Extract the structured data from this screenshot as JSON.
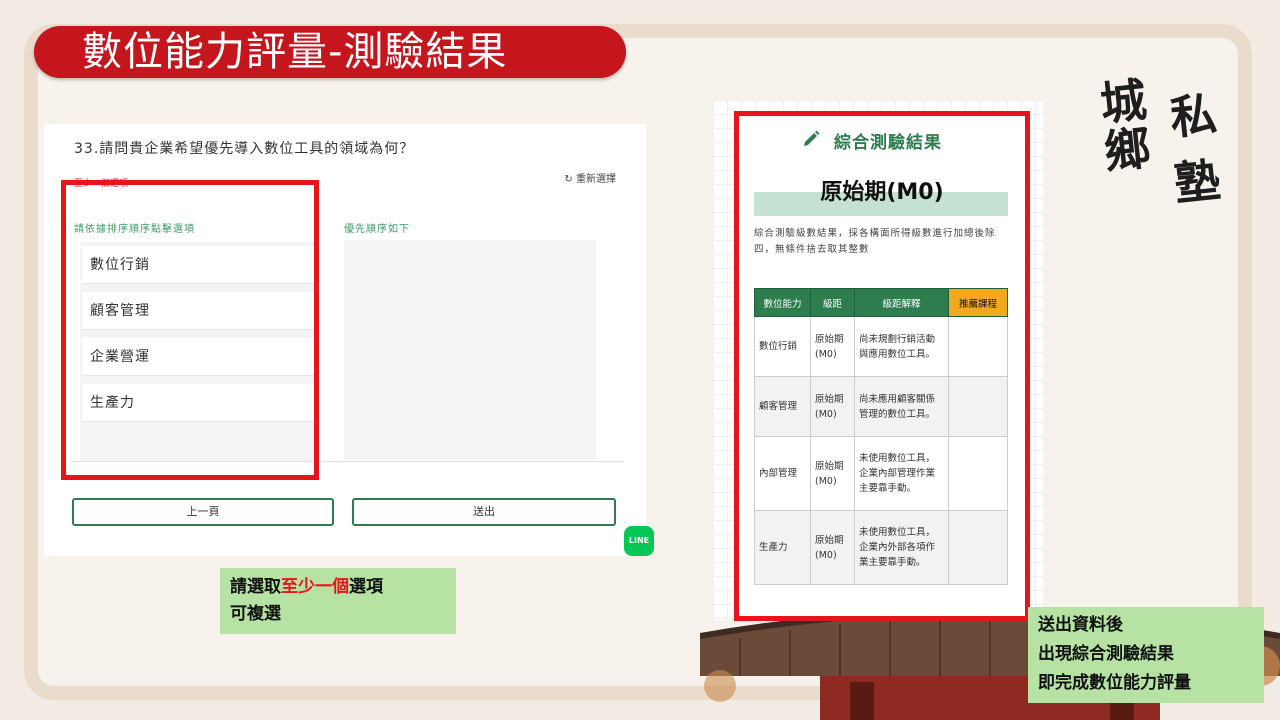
{
  "slide": {
    "title": "數位能力評量-測驗結果",
    "logo_chars": [
      "城",
      "鄉",
      "私",
      "塾"
    ]
  },
  "question_panel": {
    "question": "33.請問貴企業希望優先導入數位工具的領域為何？",
    "required_note": "至少一個選項",
    "reset_label": "重新選擇",
    "left_column_label": "請依據排序順序點擊選項",
    "right_column_label": "優先順序如下",
    "options": [
      "數位行銷",
      "顧客管理",
      "企業營運",
      "生產力"
    ],
    "prev_button": "上一頁",
    "submit_button": "送出",
    "line_badge": "LINE"
  },
  "note_left": {
    "line1_a": "請選取",
    "line1_b": "至少一個",
    "line1_c": "選項",
    "line2": "可複選"
  },
  "result_panel": {
    "header": "綜合測驗結果",
    "level": "原始期(M0)",
    "description": "綜合測驗級數結果，採各構面所得級數進行加總後除四，無條件捨去取其整數",
    "table": {
      "headers": [
        "數位能力",
        "級距",
        "級距解釋",
        "推薦課程"
      ],
      "rows": [
        {
          "ability": "數位行銷",
          "level": "原始期(M0)",
          "explanation": "尚未規劃行銷活動與應用數位工具。",
          "course": ""
        },
        {
          "ability": "顧客管理",
          "level": "原始期(M0)",
          "explanation": "尚未應用顧客關係管理的數位工具。",
          "course": ""
        },
        {
          "ability": "內部管理",
          "level": "原始期(M0)",
          "explanation": "未使用數位工具，企業內部管理作業主要靠手動。",
          "course": ""
        },
        {
          "ability": "生產力",
          "level": "原始期(M0)",
          "explanation": "未使用數位工具，企業內外部各項作業主要靠手動。",
          "course": ""
        }
      ]
    }
  },
  "note_right": {
    "line1": "送出資料後",
    "line2": "出現綜合測驗結果",
    "line3": "即完成數位能力評量"
  },
  "colors": {
    "banner": "#c4161c",
    "highlight_box": "#e8141b",
    "accent_green": "#2e7d4f",
    "note_bg": "#b6e3a4",
    "recommend_header": "#f4a81d"
  }
}
